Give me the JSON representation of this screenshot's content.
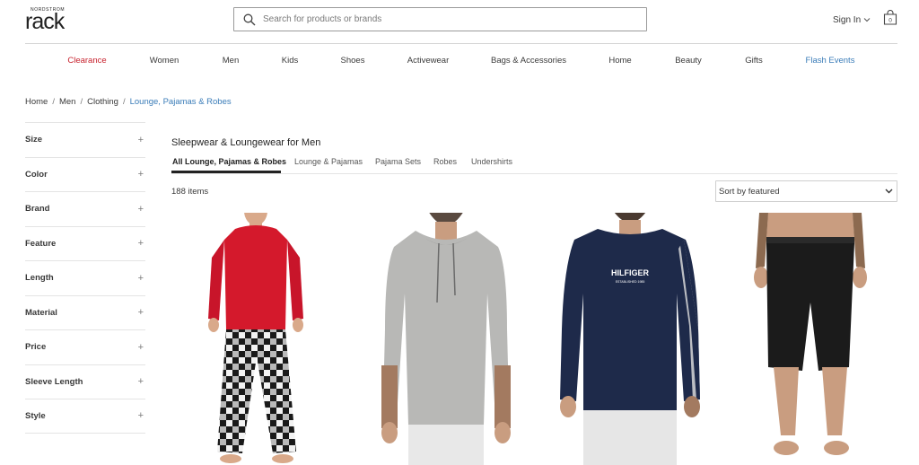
{
  "header": {
    "logo_small": "NORDSTROM",
    "logo_big": "rack",
    "search_placeholder": "Search for products or brands",
    "signin_label": "Sign In",
    "bag_count": "0"
  },
  "nav": {
    "items": [
      {
        "label": "Clearance"
      },
      {
        "label": "Women"
      },
      {
        "label": "Men"
      },
      {
        "label": "Kids"
      },
      {
        "label": "Shoes"
      },
      {
        "label": "Activewear"
      },
      {
        "label": "Bags & Accessories"
      },
      {
        "label": "Home"
      },
      {
        "label": "Beauty"
      },
      {
        "label": "Gifts"
      },
      {
        "label": "Flash Events"
      }
    ],
    "highlight_color": "#c7202c",
    "link_color": "#3a7cb8"
  },
  "breadcrumb": {
    "items": [
      "Home",
      "Men",
      "Clothing"
    ],
    "current": "Lounge, Pajamas & Robes"
  },
  "filters": {
    "items": [
      "Size",
      "Color",
      "Brand",
      "Feature",
      "Length",
      "Material",
      "Price",
      "Sleeve Length",
      "Style"
    ]
  },
  "main": {
    "title": "Sleepwear & Loungewear for Men",
    "tabs": [
      {
        "label": "All Lounge, Pajamas & Robes"
      },
      {
        "label": "Lounge & Pajamas"
      },
      {
        "label": "Pajama Sets"
      },
      {
        "label": "Robes"
      },
      {
        "label": "Undershirts"
      }
    ],
    "item_count": "188 items",
    "sort_label": "Sort by featured"
  },
  "products": {
    "items": [
      {
        "graphic": "red-shirt-plaid-pants"
      },
      {
        "graphic": "grey-hoodie"
      },
      {
        "graphic": "navy-tommy-hilfiger-tee",
        "print_text": "HILFIGER",
        "print_subtext": "ESTABLISHED 1985"
      },
      {
        "graphic": "black-lounge-shorts"
      }
    ]
  }
}
